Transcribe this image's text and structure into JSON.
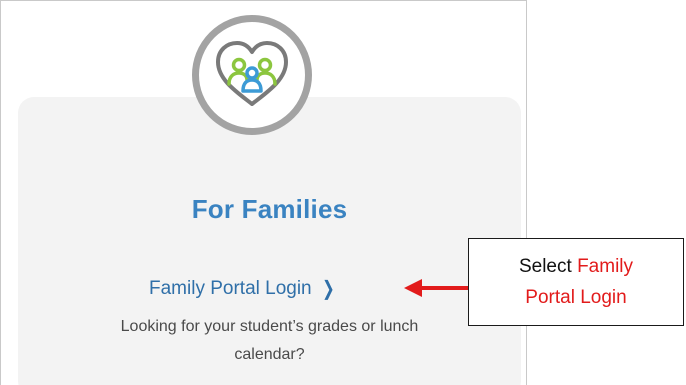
{
  "card": {
    "title": "For Families",
    "link_label": "Family Portal Login",
    "link_chevron": "❯",
    "description_line1": "Looking for your student’s grades or lunch",
    "description_line2": "calendar?",
    "badge_icon": "family-heart-icon"
  },
  "callout": {
    "prefix": "Select",
    "highlight_line1": "Family",
    "highlight_line2": "Portal Login"
  },
  "colors": {
    "title": "#3a83c1",
    "link": "#2f6fa8",
    "badge_ring": "#a3a3a3",
    "icon_green": "#8cc63f",
    "icon_blue": "#3d9bd6",
    "icon_gray": "#7a7a7a",
    "annotation_red": "#e21b1b"
  }
}
